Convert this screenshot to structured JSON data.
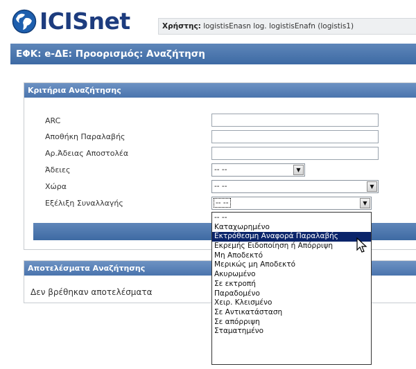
{
  "app": {
    "logo_text": "ICISnet"
  },
  "user": {
    "label": "Χρήστης:",
    "value": "logistisEnasn log. logistisEnafn (logistis1)"
  },
  "page_title": "ΕΦΚ: e-ΔΕ: Προορισμός: Αναζήτηση",
  "criteria": {
    "header": "Κριτήρια Αναζήτησης",
    "fields": [
      {
        "label": "ARC",
        "value": ""
      },
      {
        "label": "Αποθήκη Παραλαβής",
        "value": ""
      },
      {
        "label": "Αρ.Άδειας Αποστολέα",
        "value": ""
      },
      {
        "label": "Άδειες",
        "value": "-- --"
      },
      {
        "label": "Χώρα",
        "value": "-- --"
      },
      {
        "label": "Εξέλιξη Συναλλαγής",
        "value": "-- --"
      }
    ]
  },
  "results": {
    "header": "Αποτελέσματα Αναζήτησης",
    "empty_message": "Δεν βρέθηκαν αποτελέσματα"
  },
  "dropdown": {
    "options": [
      "-- --",
      "Καταχωρημένο",
      "Εκτρόθεσμη Αναφορά Παραλαβής",
      "Εκρεμής Ειδοποίηση ή Απόρριψη",
      "Μη Αποδεκτό",
      "Μερικώς μη Αποδεκτό",
      "Ακυρωμένο",
      "Σε εκτροπή",
      "Παραδομένο",
      "Χειρ. Κλεισμένο",
      "Σε Αντικατάσταση",
      "Σε απόρριψη",
      "Σταματημένο"
    ],
    "highlighted_index": 2
  },
  "icons": {
    "logo": "globe-logo-icon",
    "select_arrow": "chevron-down-icon",
    "cursor": "mouse-pointer-icon"
  },
  "colors": {
    "brand_blue": "#1d3c7e",
    "header_blue": "#4a74ad",
    "selection": "#0a246a"
  }
}
